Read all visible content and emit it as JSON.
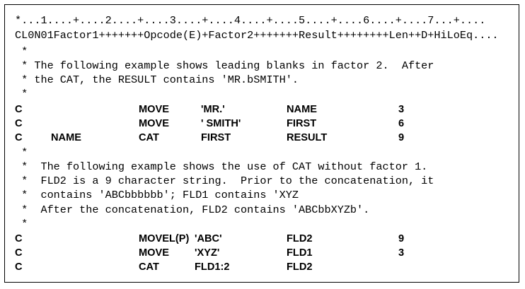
{
  "ruler": "*...1....+....2....+....3....+....4....+....5....+....6....+....7...+....",
  "spec_header": "CL0N01Factor1+++++++Opcode(E)+Factor2+++++++Result++++++++Len++D+HiLoEq....",
  "comments_1": [
    " *",
    " * The following example shows leading blanks in factor 2.  After",
    " * the CAT, the RESULT contains 'MR.bSMITH'.",
    " *"
  ],
  "specs_1": [
    {
      "c": "C",
      "factor1": "",
      "opcode": "MOVE",
      "factor2": "'MR.'",
      "result": "NAME",
      "len": "3"
    },
    {
      "c": "C",
      "factor1": "",
      "opcode": "MOVE",
      "factor2": "' SMITH'",
      "result": "FIRST",
      "len": "6"
    },
    {
      "c": "C",
      "factor1": "NAME",
      "opcode": "CAT",
      "factor2": "FIRST",
      "result": "RESULT",
      "len": "9"
    }
  ],
  "comments_2": [
    " *",
    " *  The following example shows the use of CAT without factor 1.",
    " *  FLD2 is a 9 character string.  Prior to the concatenation, it",
    " *  contains 'ABCbbbbbb'; FLD1 contains 'XYZ",
    " *  After the concatenation, FLD2 contains 'ABCbbXYZb'.",
    " *"
  ],
  "specs_2": [
    {
      "c": "C",
      "factor1": "",
      "opcode": "MOVEL(P)",
      "factor2": "'ABC'",
      "result": "FLD2",
      "len": "9"
    },
    {
      "c": "C",
      "factor1": "",
      "opcode": "MOVE",
      "factor2": "'XYZ'",
      "result": "FLD1",
      "len": "3"
    },
    {
      "c": "C",
      "factor1": "",
      "opcode": "CAT",
      "factor2": "FLD1:2",
      "result": "FLD2",
      "len": ""
    }
  ]
}
